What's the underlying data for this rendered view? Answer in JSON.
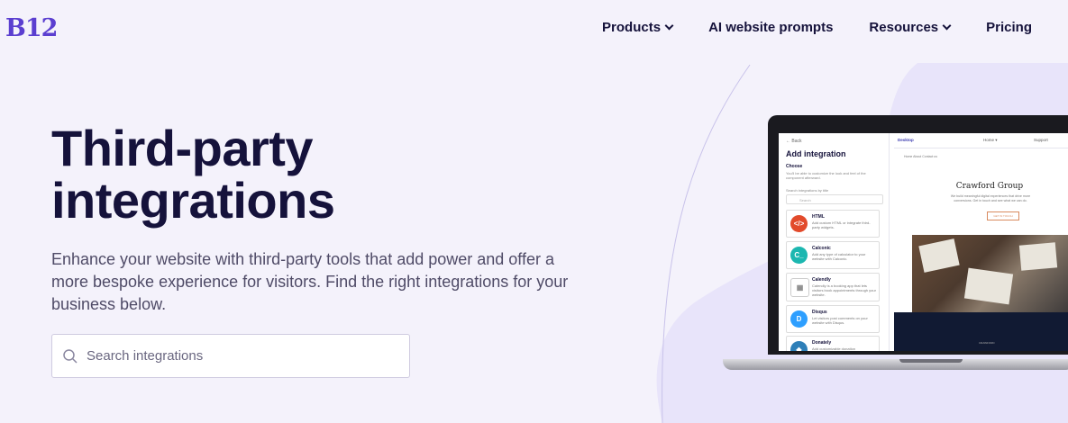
{
  "header": {
    "logo": "B12",
    "nav": [
      {
        "label": "Products",
        "dropdown": true
      },
      {
        "label": "AI website prompts",
        "dropdown": false
      },
      {
        "label": "Resources",
        "dropdown": true
      },
      {
        "label": "Pricing",
        "dropdown": false
      }
    ]
  },
  "hero": {
    "title_line1": "Third-party",
    "title_line2": "integrations",
    "description": "Enhance your website with third-party tools that add power and offer a more bespoke experience for visitors. Find the right integrations for your business below.",
    "search_placeholder": "Search integrations"
  },
  "mockup": {
    "back": "← Back",
    "panel_title": "Add integration",
    "choose": "Choose",
    "choose_desc": "You'll be able to customize the look and feel of the component afterward.",
    "search_label": "Search integrations by title",
    "search_placeholder": "Search",
    "integrations": [
      {
        "name": "HTML",
        "desc": "Add custom HTML or integrate third-party widgets.",
        "icon": "html-icon",
        "color": "#e24a2b",
        "glyph": "</>"
      },
      {
        "name": "Calconic",
        "desc": "Add any type of calculator to your website with Calconic.",
        "icon": "calconic-icon",
        "color": "#1cb7b0",
        "glyph": "C_"
      },
      {
        "name": "Calendly",
        "desc": "Calendly is a booking app that lets visitors book appointments through your website.",
        "icon": "calendly-icon",
        "color": "#ffffff",
        "glyph": "▦"
      },
      {
        "name": "Disqus",
        "desc": "Let visitors post comments on your website with Disqus.",
        "icon": "disqus-icon",
        "color": "#2e9fff",
        "glyph": "D"
      },
      {
        "name": "Donately",
        "desc": "Add customizable donation",
        "icon": "donately-icon",
        "color": "#2e7fb8",
        "glyph": "◆"
      }
    ],
    "toolbar_desktop": "Desktop",
    "toolbar_page": "Home ▾",
    "toolbar_support": "Support",
    "site_nav": "Home   About   Contact us",
    "site_title": "Crawford Group",
    "site_sub": "We build meaningful digital experiences that drive more conversions. Get in touch and see what we can do.",
    "site_button": "GET IN TOUCH",
    "site_footer": "CRAWFORD"
  },
  "colors": {
    "brand": "#5b3fd0",
    "text": "#15123b",
    "bg": "#f4f2fb",
    "blob": "#e8e4fa"
  }
}
